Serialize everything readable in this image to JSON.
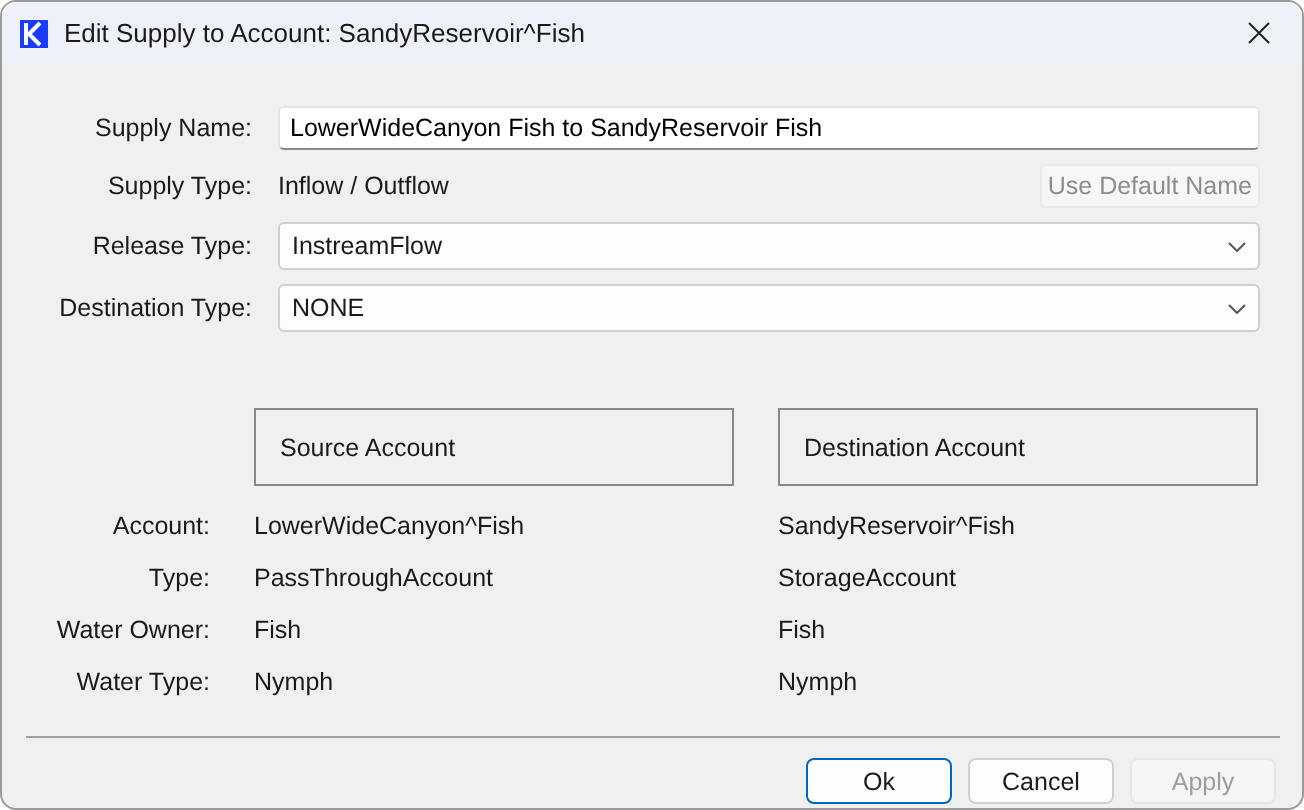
{
  "window": {
    "title": "Edit Supply to Account: SandyReservoir^Fish"
  },
  "form": {
    "fields": [
      {
        "kind": "text",
        "label": "Supply Name:",
        "value": "LowerWideCanyon Fish to SandyReservoir Fish"
      },
      {
        "kind": "static",
        "label": "Supply Type:",
        "value": "Inflow / Outflow",
        "button": {
          "label": "Use Default Name",
          "disabled": true
        }
      },
      {
        "kind": "dropdown",
        "label": "Release Type:",
        "value": "InstreamFlow"
      },
      {
        "kind": "dropdown",
        "label": "Destination Type:",
        "value": "NONE"
      }
    ]
  },
  "accounts": {
    "headers": [
      "Source Account",
      "Destination Account"
    ],
    "rows": [
      {
        "label": "Account:",
        "source": "LowerWideCanyon^Fish",
        "destination": "SandyReservoir^Fish"
      },
      {
        "label": "Type:",
        "source": "PassThroughAccount",
        "destination": "StorageAccount"
      },
      {
        "label": "Water Owner:",
        "source": "Fish",
        "destination": "Fish"
      },
      {
        "label": "Water Type:",
        "source": "Nymph",
        "destination": "Nymph"
      }
    ]
  },
  "buttons": [
    {
      "label": "Ok",
      "default": true,
      "disabled": false
    },
    {
      "label": "Cancel",
      "default": false,
      "disabled": false
    },
    {
      "label": "Apply",
      "default": false,
      "disabled": true
    }
  ]
}
